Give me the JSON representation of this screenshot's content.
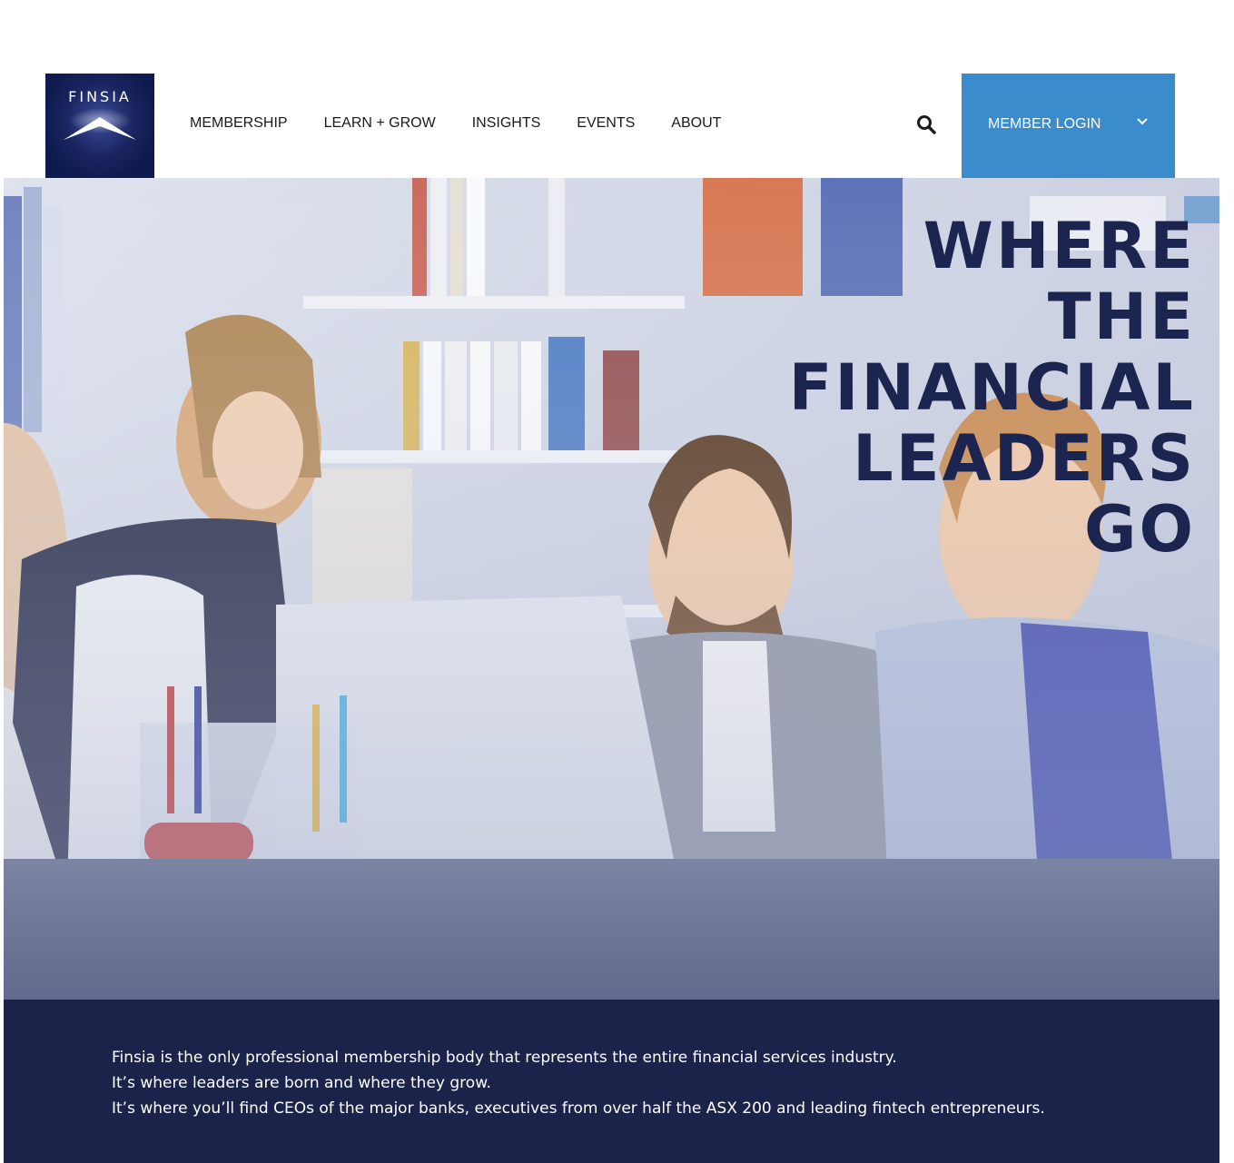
{
  "brand": {
    "logo_text": "FINSIA",
    "logo_icon": "finsia-arrow-logo-icon",
    "logo_color": "#0f1a4e"
  },
  "nav": {
    "items": [
      {
        "label": "MEMBERSHIP"
      },
      {
        "label": "LEARN + GROW"
      },
      {
        "label": "INSIGHTS"
      },
      {
        "label": "EVENTS"
      },
      {
        "label": "ABOUT"
      }
    ],
    "search_icon": "search-icon"
  },
  "login": {
    "label": "MEMBER LOGIN",
    "icon": "chevron-down-icon",
    "color": "#3a8ccc"
  },
  "hero": {
    "headline_lines": [
      "WHERE",
      "THE",
      "FINANCIAL",
      "LEADERS",
      "GO"
    ],
    "headline_color": "#1c2450"
  },
  "about": {
    "background": "#1b234b",
    "lines": [
      "Finsia is the only professional membership body that represents the entire financial services industry.",
      "It’s where leaders are born and where they grow.",
      "It’s where you’ll find CEOs of the major banks, executives from over half the ASX 200 and leading fintech entrepreneurs."
    ]
  }
}
